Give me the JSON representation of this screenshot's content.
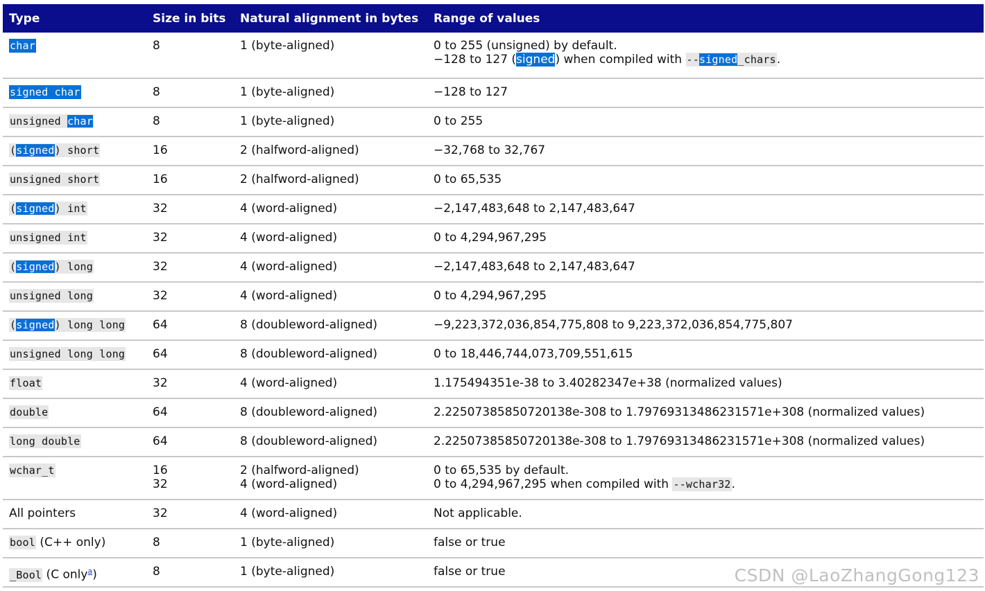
{
  "headers": [
    "Type",
    "Size in bits",
    "Natural alignment in bytes",
    "Range of values"
  ],
  "rows": [
    {
      "type": {
        "pre": "",
        "hl": "char",
        "post": ""
      },
      "size": "8",
      "align": "1 (byte-aligned)",
      "range1": "0 to 255 (unsigned) by default.",
      "range2": {
        "a": "−128 to 127 (",
        "hl": "signed",
        "b": ") when compiled with ",
        "code_pre": "--",
        "code_hl": "signed",
        "code_post": "_chars",
        "c": "."
      }
    },
    {
      "type": {
        "pre": "",
        "hl": "signed char",
        "post": ""
      },
      "size": "8",
      "align": "1 (byte-aligned)",
      "range": "−128 to 127"
    },
    {
      "type": {
        "pre": "unsigned ",
        "hl": "char",
        "post": ""
      },
      "size": "8",
      "align": "1 (byte-aligned)",
      "range": "0 to 255"
    },
    {
      "type": {
        "pre": "(",
        "hl": "signed",
        "post": ") short"
      },
      "size": "16",
      "align": "2 (halfword-aligned)",
      "range": "−32,768 to 32,767"
    },
    {
      "type": {
        "pre": "unsigned short",
        "hl": "",
        "post": ""
      },
      "size": "16",
      "align": "2 (halfword-aligned)",
      "range": "0 to 65,535"
    },
    {
      "type": {
        "pre": "(",
        "hl": "signed",
        "post": ") int"
      },
      "size": "32",
      "align": "4 (word-aligned)",
      "range": "−2,147,483,648 to 2,147,483,647"
    },
    {
      "type": {
        "pre": "unsigned int",
        "hl": "",
        "post": ""
      },
      "size": "32",
      "align": "4 (word-aligned)",
      "range": "0 to 4,294,967,295"
    },
    {
      "type": {
        "pre": "(",
        "hl": "signed",
        "post": ") long"
      },
      "size": "32",
      "align": "4 (word-aligned)",
      "range": "−2,147,483,648 to 2,147,483,647"
    },
    {
      "type": {
        "pre": "unsigned long",
        "hl": "",
        "post": ""
      },
      "size": "32",
      "align": "4 (word-aligned)",
      "range": "0 to 4,294,967,295"
    },
    {
      "type": {
        "pre": "(",
        "hl": "signed",
        "post": ") long long"
      },
      "size": "64",
      "align": "8 (doubleword-aligned)",
      "range": "−9,223,372,036,854,775,808 to 9,223,372,036,854,775,807"
    },
    {
      "type": {
        "pre": "unsigned long long",
        "hl": "",
        "post": ""
      },
      "size": "64",
      "align": "8 (doubleword-aligned)",
      "range": "0 to 18,446,744,073,709,551,615"
    },
    {
      "type": {
        "pre": "float",
        "hl": "",
        "post": ""
      },
      "size": "32",
      "align": "4 (word-aligned)",
      "range": "1.175494351e-38 to 3.40282347e+38 (normalized values)"
    },
    {
      "type": {
        "pre": "double",
        "hl": "",
        "post": ""
      },
      "size": "64",
      "align": "8 (doubleword-aligned)",
      "range": "2.22507385850720138e-308 to 1.79769313486231571e+308 (normalized values)"
    },
    {
      "type": {
        "pre": "long double",
        "hl": "",
        "post": ""
      },
      "size": "64",
      "align": "8 (doubleword-aligned)",
      "range": "2.22507385850720138e-308 to 1.79769313486231571e+308 (normalized values)"
    },
    {
      "type": {
        "pre": "wchar_t",
        "hl": "",
        "post": ""
      },
      "size1": "16",
      "size2": "32",
      "align1": "2 (halfword-aligned)",
      "align2": "4 (word-aligned)",
      "range1": "0 to 65,535 by default.",
      "range2_a": "0 to 4,294,967,295 when compiled with ",
      "range2_code": "--wchar32",
      "range2_b": "."
    },
    {
      "type_text": "All pointers",
      "size": "32",
      "align": "4 (word-aligned)",
      "range": "Not applicable."
    },
    {
      "type_code": "bool",
      "type_suffix": " (C++ only)",
      "size": "8",
      "align": "1 (byte-aligned)",
      "range": "false or true"
    },
    {
      "type_code": "_Bool",
      "type_suffix": " (C only",
      "footnote": "a",
      "type_close": ")",
      "size": "8",
      "align": "1 (byte-aligned)",
      "range": "false or true"
    }
  ],
  "watermark": "CSDN @LaoZhangGong123",
  "colors": {
    "header_bg": "#0a0d8c",
    "highlight": "#0a6fd6",
    "code_bg": "#e6e6e6"
  }
}
